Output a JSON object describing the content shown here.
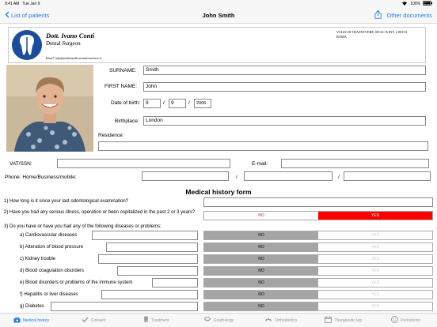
{
  "status": {
    "time": "9:41 AM",
    "date": "Tue Jan 9",
    "battery": "100%"
  },
  "nav": {
    "back_label": "List of patients",
    "title": "John Smith",
    "other_docs_label": "Other documents"
  },
  "letterhead": {
    "name": "Dott. Ivano Conti",
    "role": "Dental Surgeon",
    "email": "Email: info@studiomedicoromatrastevere.it",
    "address_line1": "VIALE DI TRASTEVERE 108 SC B INT. 2 00153",
    "address_line2": "ROMA"
  },
  "patient": {
    "surname_label": "SURNAME:",
    "surname": "Smith",
    "firstname_label": "FIRST NAME:",
    "firstname": "John",
    "dob_label": "Date of birth:",
    "dob_day": "9",
    "dob_month": "9",
    "dob_year": "2006",
    "dob_sep": "/",
    "birthplace_label": "Birthplace:",
    "birthplace": "London",
    "residence_label": "Residence:",
    "vat_label": "VAT/SSN:",
    "email_label": "E-mail:",
    "phone_label": "Phone: Home/Business/mobile:",
    "phone_sep": "/"
  },
  "form": {
    "title": "Medical history form",
    "q1": "1) How long is it since your last odontological examination?",
    "q2": "2) Have you had any serious illness, operation or been ospitalized in the past 2 or 3 years?",
    "q3": "3) Do you have or have you had any of the following diseases or problems:",
    "no": "NO",
    "yes": "YES",
    "diseases": [
      {
        "label": "a) Cardiovascular diseases"
      },
      {
        "label": "b) Alteration of blood pressure"
      },
      {
        "label": "c) Kidney trouble"
      },
      {
        "label": "d) Blood coagulation disorders"
      },
      {
        "label": "e) Blood disorders or problems of the immune system"
      },
      {
        "label": "f) Hepatitis or liver diseases"
      },
      {
        "label": "g) Diabetes"
      }
    ]
  },
  "tabs": [
    {
      "label": "Medical history",
      "icon": "briefcase-icon"
    },
    {
      "label": "Consent",
      "icon": "checkmark-icon"
    },
    {
      "label": "Treatment",
      "icon": "tooth-icon"
    },
    {
      "label": "Gnathology",
      "icon": "jaw-icon"
    },
    {
      "label": "Orthodontics",
      "icon": "orthodontics-icon"
    },
    {
      "label": "Therapeutic log",
      "icon": "calendar-icon"
    },
    {
      "label": "Pedodontic",
      "icon": "pedodontic-icon"
    }
  ],
  "colors": {
    "accent": "#1e7cf2",
    "yes_active": "#ff0000"
  }
}
